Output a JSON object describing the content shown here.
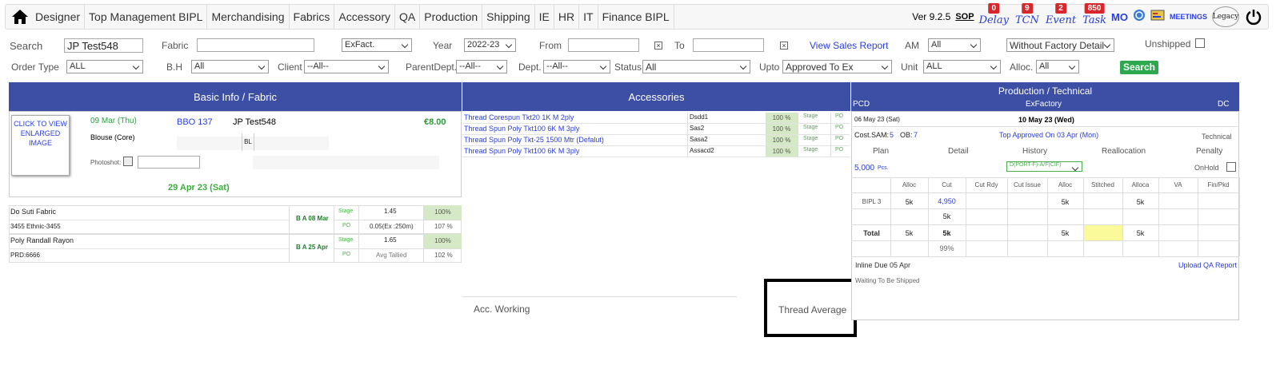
{
  "menu": {
    "items": [
      "Designer",
      "Top Management BIPL",
      "Merchandising",
      "Fabrics",
      "Accessory",
      "QA",
      "Production",
      "Shipping",
      "IE",
      "HR",
      "IT",
      "Finance BIPL"
    ],
    "version": "Ver 9.2.5",
    "sop": "SOP",
    "tools": [
      {
        "label": "Delay",
        "badge": "0"
      },
      {
        "label": "TCN",
        "badge": "9"
      },
      {
        "label": "Event",
        "badge": "2"
      },
      {
        "label": "Task",
        "badge": "850"
      }
    ],
    "mo": "MO",
    "meetings": "MEETINGS",
    "legacy": "Legacy"
  },
  "filters": {
    "search_label": "Search",
    "search_value": "JP Test548",
    "fabric_label": "Fabric",
    "fabric_value": "",
    "exfact_select": "ExFact.",
    "year_label": "Year",
    "year_value": "2022-23",
    "from_label": "From",
    "to_label": "To",
    "view_sales_report": "View Sales Report",
    "am_label": "AM",
    "am_value": "All",
    "factory_detail": "Without Factory Detail",
    "unshipped_label": "Unshipped",
    "order_type_label": "Order Type",
    "order_type_value": "ALL",
    "bh_label": "B.H",
    "bh_value": "All",
    "client_label": "Client",
    "client_value": "--All--",
    "parent_dept_label": "ParentDept.",
    "parent_dept_value": "--All--",
    "dept_label": "Dept.",
    "dept_value": "--All--",
    "status_label": "Status",
    "status_value": "All",
    "upto_label": "Upto",
    "upto_value": "Approved To Ex",
    "unit_label": "Unit",
    "unit_value": "ALL",
    "alloc_label": "Alloc.",
    "alloc_value": "All",
    "search_button": "Search"
  },
  "basic": {
    "header": "Basic Info / Fabric",
    "image_text": "CLICK TO VIEW ENLARGED IMAGE",
    "date": "09 Mar (Thu)",
    "bbo": "BBO 137",
    "style": "JP Test548",
    "price": "€8.00",
    "product": "Blouse (Core)",
    "bl": "BL",
    "photoshot": "Photoshot:",
    "ship_date": "29 Apr 23 (Sat)"
  },
  "fabrics": [
    {
      "name": "Do Suti Fabric",
      "sub": "3455 Ethnic-3455",
      "ba": "B A 08 Mar",
      "stage": "Stage",
      "po": "PO",
      "v1": "1.45",
      "v2": "0.05(Ex :250m)",
      "p1": "100%",
      "p2": "107 %"
    },
    {
      "name": "Poly Randall Rayon",
      "sub": "PRD:6666",
      "ba": "B A 25 Apr",
      "stage": "Stage",
      "po": "PO",
      "v1": "1.65",
      "v2": "Avg Tallied",
      "p1": "100%",
      "p2": "102 %"
    }
  ],
  "accessories": {
    "header": "Accessories",
    "rows": [
      {
        "name": "Thread Corespun Tkt20 1K M 2ply",
        "code": "Dsdd1",
        "pct": "100 %",
        "stage": "Stage",
        "po": "PO"
      },
      {
        "name": "Thread Spun Poly Tkt100 6K M 3ply",
        "code": "Sas2",
        "pct": "100 %",
        "stage": "Stage",
        "po": "PO"
      },
      {
        "name": "Thread Spun Poly Tkt-25 1500 Mtr (Defalut)",
        "code": "Sasa2",
        "pct": "100 %",
        "stage": "Stage",
        "po": "PO"
      },
      {
        "name": "Thread Spun Poly Tkt100 6K M 3ply",
        "code": "Assacd2",
        "pct": "100 %",
        "stage": "Stage",
        "po": "PO"
      }
    ],
    "acc_working": "Acc. Working",
    "thread_average": "Thread Average"
  },
  "production": {
    "header": "Production / Technical",
    "pcd": "PCD",
    "exfactory": "ExFactory",
    "dc": "DC",
    "pcd_date": "06 May 23 (Sat)",
    "exf_date": "10 May 23 (Wed)",
    "cost_sam": "Cost.SAM:",
    "cost_sam_v": "5",
    "ob": "OB:",
    "ob_v": "7",
    "top_approved": "Top Approved On 03 Apr (Mon)",
    "technical": "Technical",
    "tabs": [
      "Plan",
      "Detail",
      "History",
      "Reallocation",
      "Penalty"
    ],
    "qty": "5,000",
    "pcs": "Pcs.",
    "port": "D(PORT-F)-A/F(CIF)",
    "onhold": "OnHold",
    "cols": [
      "Alloc",
      "Cut",
      "Cut Rdy",
      "Cut Issue",
      "Alloc",
      "Stitched",
      "Alloca",
      "VA",
      "Fin/Pkd"
    ],
    "unit_row": {
      "name": "BIPL 3",
      "alloc": "5k",
      "cut": "4,950",
      "cut2": "5k",
      "alloc2": "5k",
      "alloca": "5k"
    },
    "total_row": {
      "name": "Total",
      "alloc": "5k",
      "cut": "5k",
      "pct": "99%",
      "alloc2": "5k",
      "alloca": "5k"
    },
    "inline_due": "Inline Due 05 Apr",
    "upload_qa": "Upload QA Report",
    "waiting": "Waiting To Be Shipped"
  }
}
